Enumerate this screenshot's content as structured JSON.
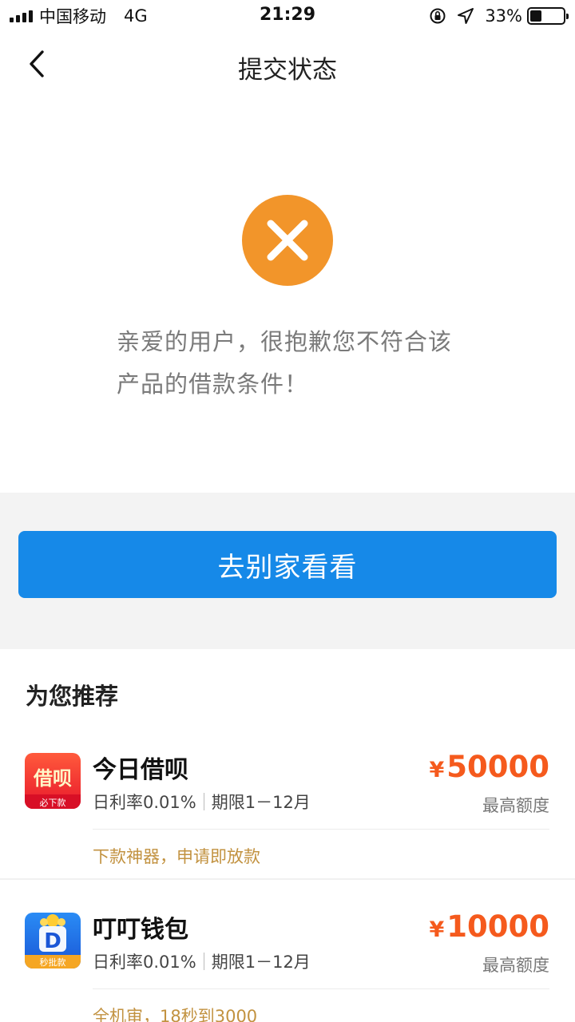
{
  "status_bar": {
    "carrier": "中国移动",
    "network": "4G",
    "time": "21:29",
    "battery_percent": "33%",
    "battery_level": 0.33,
    "icons": [
      "signal-icon",
      "orientation-lock-icon",
      "location-arrow-icon",
      "battery-icon"
    ]
  },
  "nav": {
    "title": "提交状态",
    "back_icon": "chevron-left-icon"
  },
  "result": {
    "icon": "close-circle-icon",
    "icon_color": "#f2952a",
    "message_line1": "亲爱的用户，很抱歉您不符合该",
    "message_line2": "产品的借款条件！"
  },
  "action": {
    "button_label": "去别家看看",
    "button_color": "#1689e8"
  },
  "recommend": {
    "title": "为您推荐",
    "products": [
      {
        "name": "今日借呗",
        "logo_text": "借呗",
        "logo_badge": "必下款",
        "rate": "日利率0.01%",
        "term": "期限1－12月",
        "currency": "¥",
        "amount": "50000",
        "amount_label": "最高额度",
        "tagline": "下款神器，申请即放款"
      },
      {
        "name": "叮叮钱包",
        "logo_text": "D",
        "logo_badge": "秒批款",
        "rate": "日利率0.01%",
        "term": "期限1－12月",
        "currency": "¥",
        "amount": "10000",
        "amount_label": "最高额度",
        "tagline": "全机审，18秒到3000"
      }
    ]
  },
  "colors": {
    "accent_orange": "#f55a1d",
    "tagline_gold": "#c29240",
    "primary_blue": "#1689e8"
  }
}
